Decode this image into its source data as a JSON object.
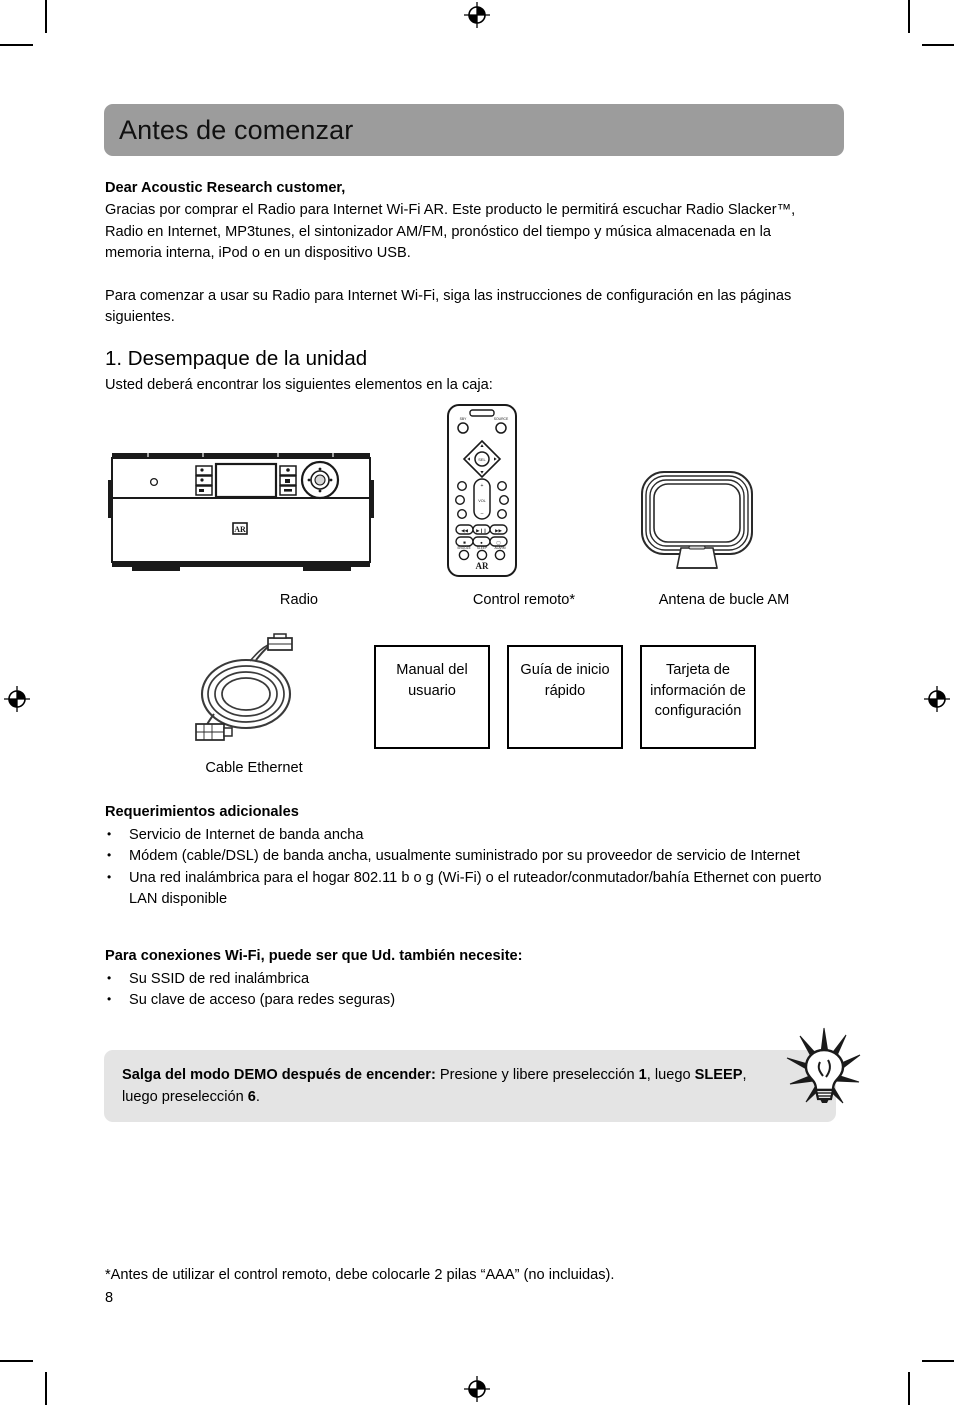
{
  "header": {
    "title": "Antes de comenzar"
  },
  "intro": {
    "salutation": "Dear Acoustic Research customer,",
    "paragraph1": "Gracias por comprar el Radio para Internet Wi-Fi AR. Este producto le permitirá escuchar Radio Slacker™, Radio en Internet, MP3tunes, el sintonizador AM/FM, pronóstico del tiempo y música almacenada en la memoria interna, iPod o en un dispositivo USB.",
    "paragraph2": "Para comenzar a usar su Radio para Internet Wi-Fi, siga las instrucciones de configuración en las páginas siguientes."
  },
  "section1": {
    "heading": "1. Desempaque de la unidad",
    "subheading": "Usted deberá encontrar los siguientes elementos en la caja:",
    "captions": {
      "radio": "Radio",
      "remote": "Control remoto*",
      "antenna": "Antena de bucle AM",
      "cable": "Cable Ethernet"
    },
    "doc_boxes": [
      "Manual del usuario",
      "Guía de inicio rápido",
      "Tarjeta de información de configuración"
    ]
  },
  "requirements": {
    "title": "Requerimientos adicionales",
    "items": [
      "Servicio de Internet de banda ancha",
      "Módem (cable/DSL) de banda ancha, usualmente suministrado por su proveedor de servicio de Internet",
      "Una red inalámbrica para el hogar 802.11 b o g (Wi-Fi) o el ruteador/conmutador/bahía Ethernet con puerto LAN disponible"
    ]
  },
  "wifi_requirements": {
    "title": "Para conexiones Wi-Fi, puede ser que Ud. también necesite:",
    "items": [
      "Su SSID de red inalámbrica",
      "Su clave de acceso (para redes seguras)"
    ]
  },
  "tip": {
    "bold_lead": "Salga del modo DEMO después de encender:",
    "text_part1": " Presione y libere preselección ",
    "bold_1": "1",
    "text_part2": ", luego ",
    "bold_sleep": "SLEEP",
    "text_part3": ", luego preselección ",
    "bold_6": "6",
    "text_part4": "."
  },
  "footer": {
    "footnote": "*Antes de utilizar el control remoto, debe colocarle 2 pilas “AAA” (no incluidas).",
    "page_number": "8"
  },
  "colors": {
    "header_bar": "#9c9c9c",
    "tip_box": "#e4e4e4",
    "ink": "#000000",
    "page": "#ffffff"
  }
}
